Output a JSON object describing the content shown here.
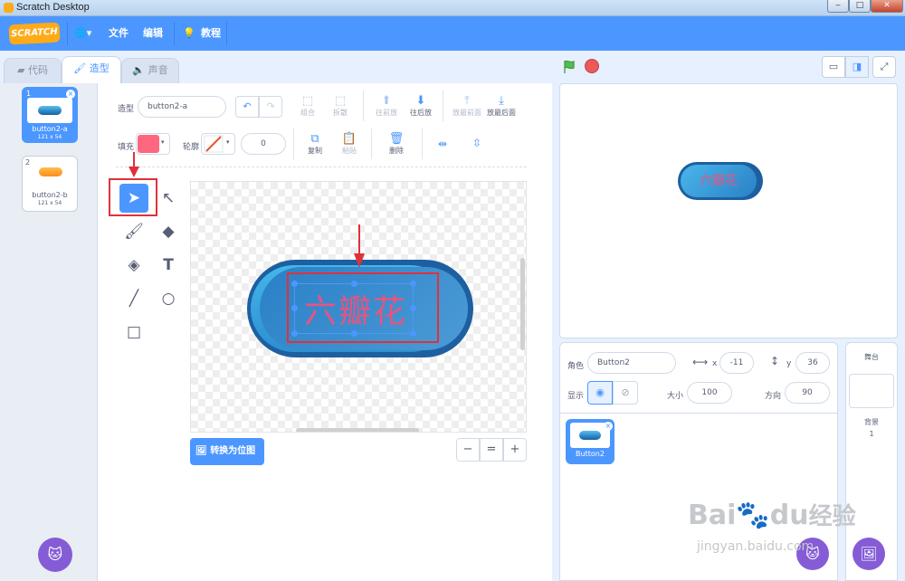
{
  "window": {
    "title": "Scratch Desktop",
    "min": "‒",
    "max": "□",
    "close": "✕"
  },
  "menu": {
    "logo": "SCRATCH",
    "globe": "🌐▾",
    "file": "文件",
    "edit": "编辑",
    "tutorials_icon": "💡",
    "tutorials": "教程"
  },
  "tabs": {
    "code": "代码",
    "costumes": "造型",
    "sounds": "声音"
  },
  "stage_controls": {
    "flag_color": "#4cbf56",
    "stop_color": "#ec5959"
  },
  "costumes": [
    {
      "num": "1",
      "name": "button2-a",
      "size": "121 x 54",
      "selected": true
    },
    {
      "num": "2",
      "name": "button2-b",
      "size": "121 x 54",
      "selected": false
    }
  ],
  "editor": {
    "costume_label": "造型",
    "costume_name": "button2-a",
    "group": "组合",
    "ungroup": "拆散",
    "forward": "往前放",
    "backward": "往后放",
    "front": "放最前面",
    "back": "放最后面",
    "fill_label": "填充",
    "outline_label": "轮廓",
    "outline_width": "0",
    "copy": "复制",
    "paste": "粘贴",
    "delete": "删除",
    "fill_color": "#ff6680",
    "convert_bitmap": "转换为位图",
    "zoom_out": "−",
    "zoom_reset": "=",
    "zoom_in": "+",
    "canvas_text": "六瓣花"
  },
  "stage": {
    "button_text": "六瓣花"
  },
  "sprite_info": {
    "sprite_label": "角色",
    "sprite_name": "Button2",
    "x_label": "x",
    "x": "-11",
    "y_label": "y",
    "y": "36",
    "show_label": "显示",
    "size_label": "大小",
    "size": "100",
    "direction_label": "方向",
    "direction": "90"
  },
  "sprites": [
    {
      "name": "Button2"
    }
  ],
  "stage_panel": {
    "title": "舞台",
    "backdrops_label": "背景",
    "backdrops_count": "1"
  },
  "watermark": {
    "main": "Bai",
    "paw": "du",
    "cn": "经验",
    "url": "jingyan.baidu.com"
  }
}
